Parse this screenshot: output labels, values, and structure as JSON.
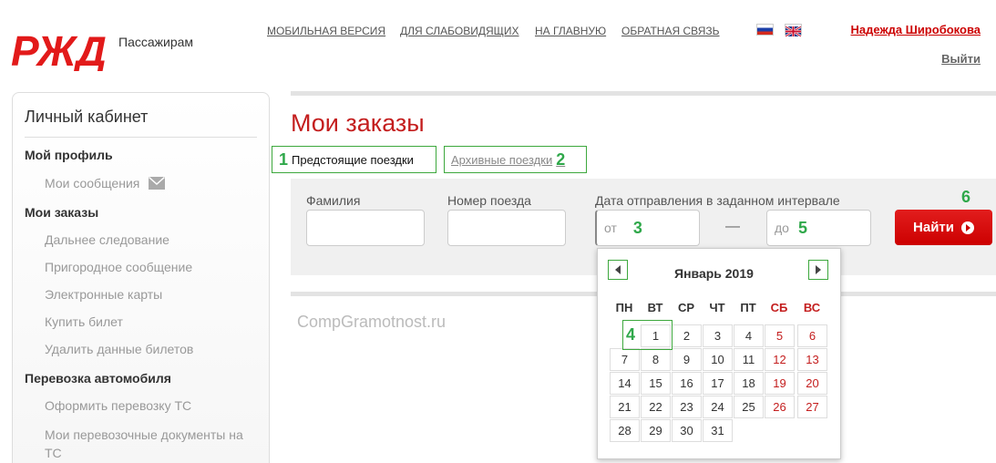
{
  "header": {
    "logo_text": "Пассажирам",
    "nav": [
      "МОБИЛЬНАЯ ВЕРСИЯ",
      "ДЛЯ СЛАБОВИДЯЩИХ",
      "НА ГЛАВНУЮ",
      "ОБРАТНАЯ СВЯЗЬ"
    ],
    "flags": [
      "flag-ru-icon",
      "flag-gb-icon"
    ],
    "user_name": "Надежда Широбокова",
    "logout": "Выйти",
    "brand_color": "#e21a1a"
  },
  "sidebar": {
    "title": "Личный кабинет",
    "sections": [
      {
        "label": "Мой профиль",
        "items": [
          "Мои сообщения"
        ]
      },
      {
        "label": "Мои заказы",
        "items": [
          "Дальнее следование",
          "Пригородное сообщение",
          "Электронные карты",
          "Купить билет",
          "Удалить данные билетов"
        ]
      },
      {
        "label": "Перевозка автомобиля",
        "items": [
          "Оформить перевозку ТС",
          "Мои перевозочные документы на ТС"
        ]
      }
    ]
  },
  "main": {
    "title": "Мои заказы",
    "tabs": [
      {
        "num": "1",
        "label": "Предстоящие поездки"
      },
      {
        "num": "2",
        "label": "Архивные поездки"
      }
    ],
    "search": {
      "surname_label": "Фамилия",
      "train_label": "Номер поезда",
      "date_label": "Дата отправления в заданном интервале",
      "from_placeholder": "от",
      "from_num": "3",
      "dash": "—",
      "to_placeholder": "до",
      "to_num": "5",
      "find_label": "Найти",
      "find_num": "6"
    },
    "watermark": "CompGramotnost.ru"
  },
  "calendar": {
    "month": "Январь 2019",
    "weekdays": [
      "ПН",
      "ВТ",
      "СР",
      "ЧТ",
      "ПТ",
      "СБ",
      "ВС"
    ],
    "weeks": [
      [
        "",
        "1",
        "2",
        "3",
        "4",
        "5",
        "6"
      ],
      [
        "7",
        "8",
        "9",
        "10",
        "11",
        "12",
        "13"
      ],
      [
        "14",
        "15",
        "16",
        "17",
        "18",
        "19",
        "20"
      ],
      [
        "21",
        "22",
        "23",
        "24",
        "25",
        "26",
        "27"
      ],
      [
        "28",
        "29",
        "30",
        "31",
        "",
        "",
        ""
      ]
    ],
    "today_num": "4",
    "weekend_color": "#c41e1e",
    "highlight_color": "#2fa84a"
  }
}
